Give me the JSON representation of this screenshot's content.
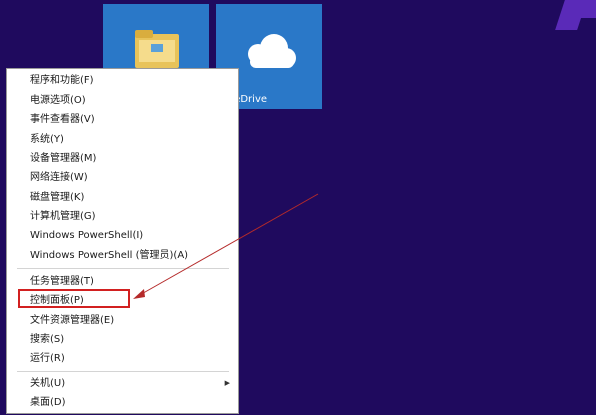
{
  "tiles": [
    {
      "id": "explorer",
      "label": ""
    },
    {
      "id": "onedrive",
      "label": "OneDrive"
    }
  ],
  "menu": {
    "items": [
      {
        "label": "程序和功能(F)"
      },
      {
        "label": "电源选项(O)"
      },
      {
        "label": "事件查看器(V)"
      },
      {
        "label": "系统(Y)"
      },
      {
        "label": "设备管理器(M)"
      },
      {
        "label": "网络连接(W)"
      },
      {
        "label": "磁盘管理(K)"
      },
      {
        "label": "计算机管理(G)"
      },
      {
        "label": "Windows PowerShell(I)"
      },
      {
        "label": "Windows PowerShell (管理员)(A)"
      },
      {
        "label": "任务管理器(T)"
      },
      {
        "label": "控制面板(P)"
      },
      {
        "label": "文件资源管理器(E)"
      },
      {
        "label": "搜索(S)"
      },
      {
        "label": "运行(R)"
      },
      {
        "label": "关机(U)"
      },
      {
        "label": "桌面(D)"
      }
    ]
  },
  "colors": {
    "desktop": "#1f0a5e",
    "tile": "#2a78c8",
    "highlight": "#d22020",
    "annotation_arrow": "#b52a2a"
  }
}
